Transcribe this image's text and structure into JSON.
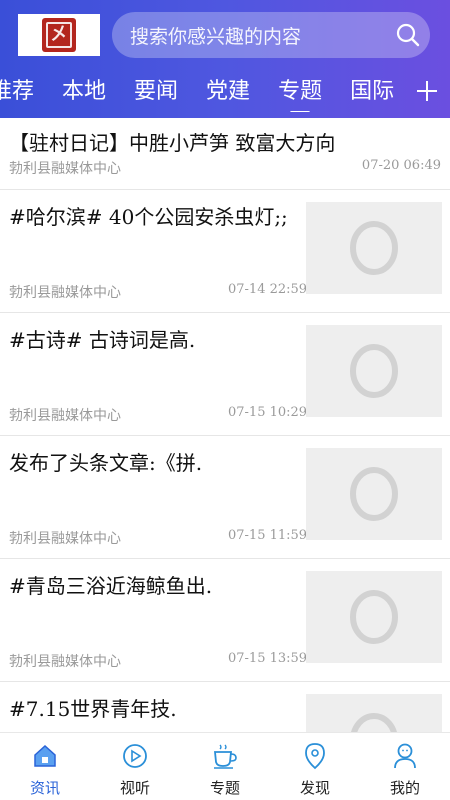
{
  "header": {
    "logo_text": "㐅",
    "search": {
      "placeholder": "搜索你感兴趣的内容"
    },
    "tabs": [
      {
        "label": "推荐",
        "active": false
      },
      {
        "label": "本地",
        "active": false
      },
      {
        "label": "要闻",
        "active": false
      },
      {
        "label": "党建",
        "active": false
      },
      {
        "label": "专题",
        "active": true
      },
      {
        "label": "国际",
        "active": false
      }
    ]
  },
  "feed": [
    {
      "title": "【驻村日记】中胜小芦笋 致富大方向",
      "source": "勃利县融媒体中心",
      "time": "07-20 06:49",
      "has_thumb": false
    },
    {
      "title": "#哈尔滨# 40个公园安杀虫灯;;",
      "source": "勃利县融媒体中心",
      "time": "07-14 22:59",
      "has_thumb": true
    },
    {
      "title": "#古诗# 古诗词是高.",
      "source": "勃利县融媒体中心",
      "time": "07-15 10:29",
      "has_thumb": true
    },
    {
      "title": "发布了头条文章:《拼.",
      "source": "勃利县融媒体中心",
      "time": "07-15 11:59",
      "has_thumb": true
    },
    {
      "title": "#青岛三浴近海鲸鱼出.",
      "source": "勃利县融媒体中心",
      "time": "07-15 13:59",
      "has_thumb": true
    },
    {
      "title": "#7.15世界青年技.",
      "source": "",
      "time": "",
      "has_thumb": true
    }
  ],
  "bottom_nav": [
    {
      "label": "资讯",
      "icon": "home-icon",
      "active": true
    },
    {
      "label": "视听",
      "icon": "play-icon",
      "active": false
    },
    {
      "label": "专题",
      "icon": "cup-icon",
      "active": false
    },
    {
      "label": "发现",
      "icon": "location-icon",
      "active": false
    },
    {
      "label": "我的",
      "icon": "user-icon",
      "active": false
    }
  ],
  "colors": {
    "header_start": "#3a4fd8",
    "header_end": "#6b4fe0",
    "nav_active": "#2a63d8",
    "seal_red": "#b3261e"
  }
}
